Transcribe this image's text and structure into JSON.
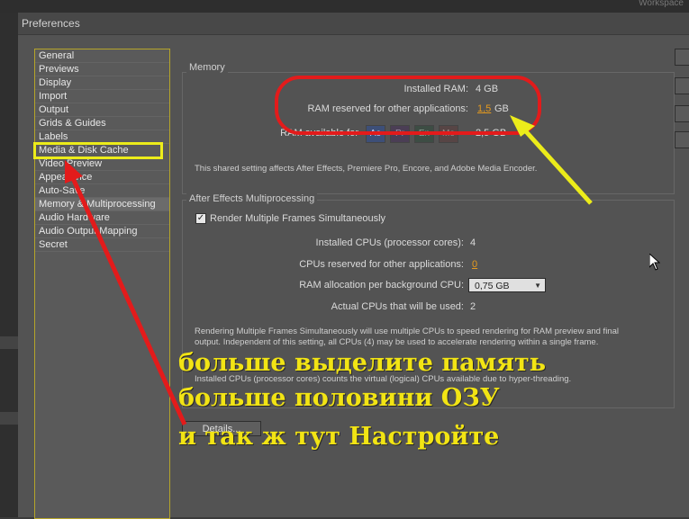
{
  "window": {
    "title": "Preferences",
    "workspace_label": "Workspace"
  },
  "nav": {
    "items": [
      "General",
      "Previews",
      "Display",
      "Import",
      "Output",
      "Grids & Guides",
      "Labels",
      "Media & Disk Cache",
      "Video Preview",
      "Appearance",
      "Auto-Save",
      "Memory & Multiprocessing",
      "Audio Hardware",
      "Audio Output Mapping",
      "Secret"
    ],
    "selected": "Memory & Multiprocessing",
    "highlighted": "Media & Disk Cache"
  },
  "memory": {
    "legend": "Memory",
    "installed_ram_label": "Installed RAM:",
    "installed_ram_value": "4 GB",
    "reserved_label": "RAM reserved for other applications:",
    "reserved_value": "1,5",
    "reserved_unit": "GB",
    "available_label": "RAM available for",
    "apps": [
      "Ae",
      "Pr",
      "En",
      "Me"
    ],
    "available_value": "2,5 GB",
    "note": "This shared setting affects After Effects, Premiere Pro, Encore, and Adobe Media Encoder."
  },
  "mp": {
    "legend": "After Effects Multiprocessing",
    "render_multiple_label": "Render Multiple Frames Simultaneously",
    "render_multiple_checked": true,
    "installed_cpus_label": "Installed CPUs (processor cores):",
    "installed_cpus_value": "4",
    "reserved_cpus_label": "CPUs reserved for other applications:",
    "reserved_cpus_value": "0",
    "ram_alloc_label": "RAM allocation per background CPU:",
    "ram_alloc_value": "0,75 GB",
    "actual_cpus_label": "Actual CPUs that will be used:",
    "actual_cpus_value": "2",
    "note1": "Rendering Multiple Frames Simultaneously will use multiple CPUs to speed rendering for RAM preview and final output. Independent of this setting, all CPUs (4) may be used to accelerate rendering within a single frame.",
    "note2": "Installed CPUs (processor cores) counts the virtual (logical) CPUs available due to hyper-threading.",
    "details_label": "Details..."
  },
  "annotation": {
    "line1": "больше выделите память",
    "line2": "больше половини ОЗУ",
    "line3": "и так ж тут Настройте"
  },
  "colors": {
    "highlight_yellow": "#ecec1a",
    "annotation_red": "#e31b1b",
    "value_orange": "#e59a1e"
  }
}
